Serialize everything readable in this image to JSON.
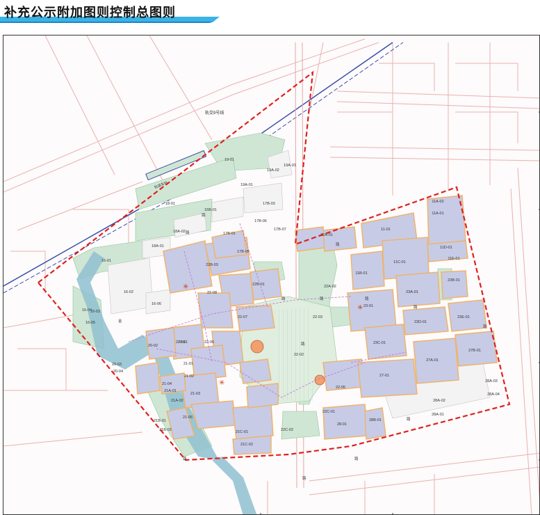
{
  "title": "补充公示附加图则控制总图则",
  "colors": {
    "title_accent": "#3ab3e6",
    "boundary": "#e02020",
    "road_line": "#e8a5a5",
    "parcel_fill": "#c7cbe6",
    "parcel_outline": "#f0b36a",
    "green_fill": "#cfe6d4",
    "green_dark": "#8fc49b",
    "water": "#8fbfd0",
    "rail": "#3a4fa8",
    "purple_line": "#c070d0"
  },
  "map": {
    "rail_label": "轨交9号线",
    "station_label": "轨道车站",
    "roads": [
      "路",
      "路",
      "路",
      "路",
      "路",
      "路",
      "路",
      "路",
      "路",
      "路",
      "路",
      "金",
      "路",
      "路"
    ],
    "parcels": [
      "19-01",
      "19A-02",
      "19A-01",
      "19A-03",
      "18-01",
      "15B-01",
      "17B-03",
      "17B-06",
      "18A-02",
      "17B-07",
      "18A-01",
      "17B-01",
      "17B-05",
      "16-01",
      "16-02",
      "16-03",
      "16-04",
      "16-05",
      "16-06",
      "22B-03",
      "22B-01",
      "22-08",
      "22-07",
      "22-06",
      "22-01",
      "22-02",
      "22-05",
      "22-03",
      "22C-01",
      "22C-02",
      "20-01",
      "20-02",
      "20-03",
      "20-04",
      "21-01",
      "21-02",
      "21-03",
      "21-04",
      "21-05",
      "21A-01",
      "21A-02",
      "21B-01",
      "21B-02",
      "21C-01",
      "21C-02",
      "11B-01",
      "11-01",
      "11C-01",
      "11A-01",
      "11A-02",
      "11D-01",
      "11E-01",
      "23-01",
      "23A-01",
      "23B-01",
      "23C-01",
      "23D-01",
      "23E-01",
      "27-01",
      "27A-01",
      "27B-01",
      "28-01",
      "28A-01",
      "28A-02",
      "28A-03",
      "28A-04",
      "28B-01",
      "22A-01",
      "22A-02"
    ]
  }
}
